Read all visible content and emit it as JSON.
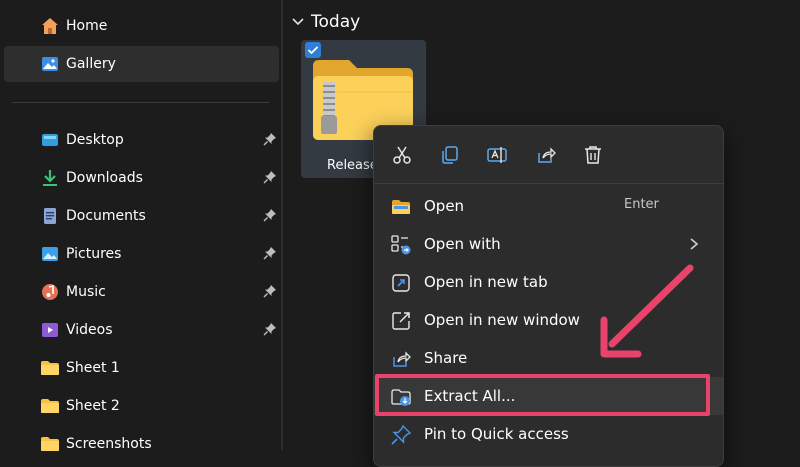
{
  "sidebar": {
    "items": [
      {
        "label": "Home",
        "icon": "home-icon",
        "pinned": false,
        "selected": false
      },
      {
        "label": "Gallery",
        "icon": "gallery-icon",
        "pinned": false,
        "selected": true
      },
      {
        "label": "Desktop",
        "icon": "desktop-icon",
        "pinned": true,
        "selected": false
      },
      {
        "label": "Downloads",
        "icon": "downloads-icon",
        "pinned": true,
        "selected": false
      },
      {
        "label": "Documents",
        "icon": "documents-icon",
        "pinned": true,
        "selected": false
      },
      {
        "label": "Pictures",
        "icon": "pictures-icon",
        "pinned": true,
        "selected": false
      },
      {
        "label": "Music",
        "icon": "music-icon",
        "pinned": true,
        "selected": false
      },
      {
        "label": "Videos",
        "icon": "videos-icon",
        "pinned": true,
        "selected": false
      },
      {
        "label": "Sheet 1",
        "icon": "folder-icon",
        "pinned": false,
        "selected": false
      },
      {
        "label": "Sheet 2",
        "icon": "folder-icon",
        "pinned": false,
        "selected": false
      },
      {
        "label": "Screenshots",
        "icon": "folder-icon",
        "pinned": false,
        "selected": false
      }
    ]
  },
  "content": {
    "group_label": "Today",
    "file": {
      "name": "Release",
      "selected": true,
      "icon": "zip-folder-icon"
    }
  },
  "context_menu": {
    "toolbar": [
      {
        "name": "cut-icon",
        "tooltip": "Cut"
      },
      {
        "name": "copy-icon",
        "tooltip": "Copy"
      },
      {
        "name": "rename-icon",
        "tooltip": "Rename"
      },
      {
        "name": "share-icon",
        "tooltip": "Share"
      },
      {
        "name": "delete-icon",
        "tooltip": "Delete"
      }
    ],
    "items": [
      {
        "label": "Open",
        "shortcut": "Enter",
        "icon": "open-folder-icon",
        "submenu": false
      },
      {
        "label": "Open with",
        "shortcut": "",
        "icon": "open-with-icon",
        "submenu": true
      },
      {
        "label": "Open in new tab",
        "shortcut": "",
        "icon": "new-tab-icon",
        "submenu": false
      },
      {
        "label": "Open in new window",
        "shortcut": "",
        "icon": "new-window-icon",
        "submenu": false
      },
      {
        "label": "Share",
        "shortcut": "",
        "icon": "share-icon",
        "submenu": false
      },
      {
        "label": "Extract All...",
        "shortcut": "",
        "icon": "extract-icon",
        "submenu": false,
        "highlighted": true
      },
      {
        "label": "Pin to Quick access",
        "shortcut": "",
        "icon": "pin-icon",
        "submenu": false
      }
    ]
  },
  "colors": {
    "background": "#1c1c1c",
    "menu_background": "#2c2c2c",
    "accent": "#2f7fd6",
    "annotation": "#e8436a",
    "folder_yellow": "#f5c242"
  }
}
